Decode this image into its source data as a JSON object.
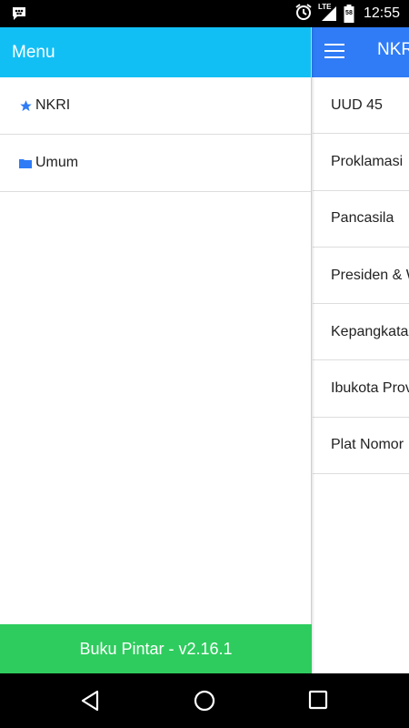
{
  "status_bar": {
    "time": "12:55",
    "network": "LTE",
    "battery_level": "58"
  },
  "main": {
    "title": "NKRI",
    "items": [
      {
        "label": "UUD 45"
      },
      {
        "label": "Proklamasi"
      },
      {
        "label": "Pancasila"
      },
      {
        "label": "Presiden & Wakil"
      },
      {
        "label": "Kepangkatan"
      },
      {
        "label": "Ibukota Provinsi"
      },
      {
        "label": "Plat Nomor"
      }
    ]
  },
  "drawer": {
    "title": "Menu",
    "items": [
      {
        "label": "NKRI",
        "icon": "star-icon"
      },
      {
        "label": "Umum",
        "icon": "folder-icon"
      }
    ],
    "footer": "Buku Pintar - v2.16.1"
  },
  "colors": {
    "drawer_header": "#12bff5",
    "app_bar": "#2f7cf6",
    "footer": "#2ecc5e",
    "icon_blue": "#2f7cf6"
  }
}
